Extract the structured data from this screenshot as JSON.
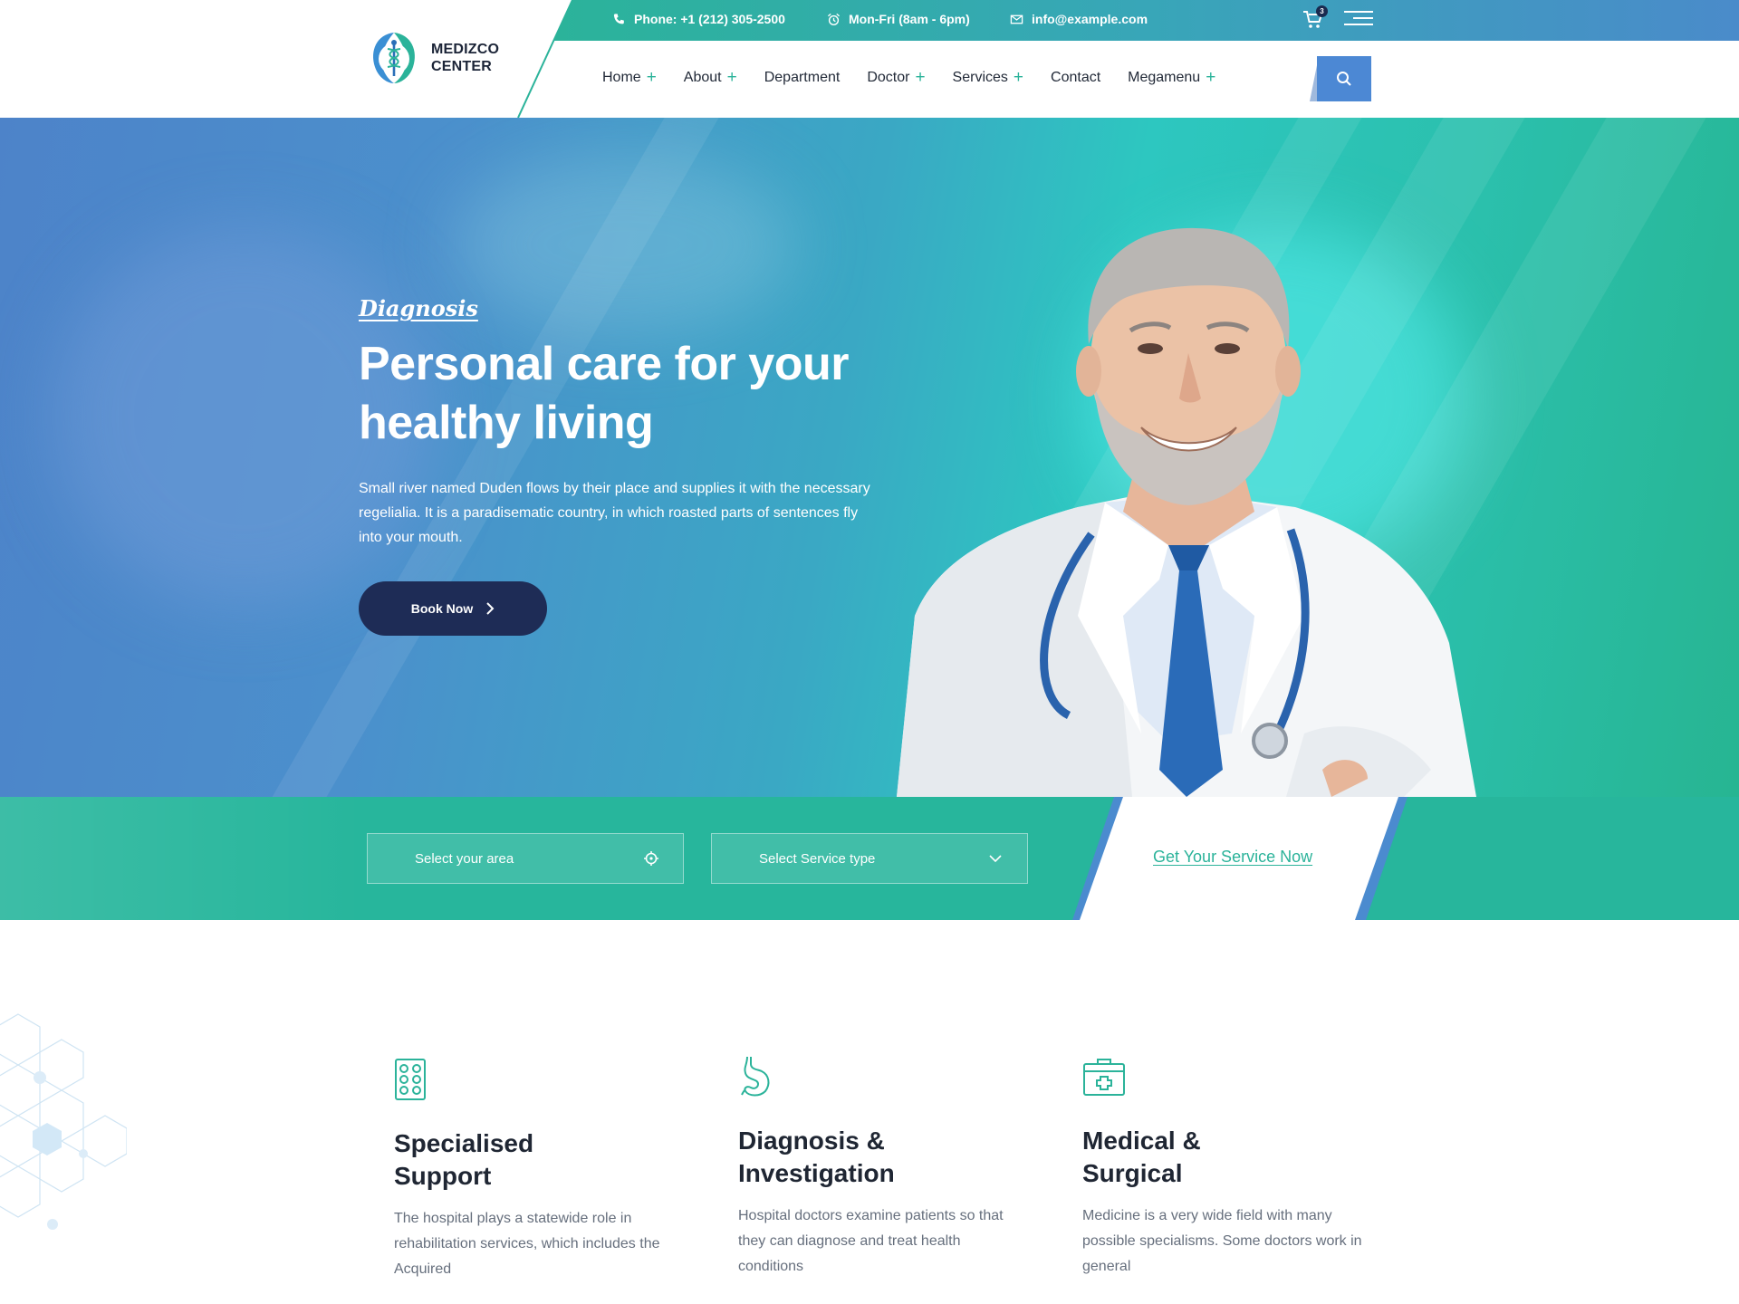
{
  "colors": {
    "accent": "#2bb39a",
    "primary": "#4c88d4",
    "dark": "#1e2c56"
  },
  "topbar": {
    "phone": "Phone: +1 (212) 305-2500",
    "hours": "Mon-Fri (8am - 6pm)",
    "email": "info@example.com",
    "cart_count": "3"
  },
  "logo": {
    "line1": "MEDIZCO",
    "line2": "CENTER"
  },
  "nav": {
    "items": [
      {
        "label": "Home",
        "has_submenu": true
      },
      {
        "label": "About",
        "has_submenu": true
      },
      {
        "label": "Department",
        "has_submenu": false
      },
      {
        "label": "Doctor",
        "has_submenu": true
      },
      {
        "label": "Services",
        "has_submenu": true
      },
      {
        "label": "Contact",
        "has_submenu": false
      },
      {
        "label": "Megamenu",
        "has_submenu": true
      }
    ],
    "plus_symbol": "+"
  },
  "hero": {
    "eyebrow": "Diagnosis",
    "title_line1": "Personal care for your",
    "title_line2": "healthy living",
    "text": "Small river named Duden flows by their place and supplies it with the necessary regelialia. It is a paradisematic country, in which roasted parts of sentences fly into your mouth.",
    "button": "Book Now"
  },
  "service_strip": {
    "area_placeholder": "Select your area",
    "service_placeholder": "Select Service type",
    "cta": "Get Your Service Now"
  },
  "features": [
    {
      "icon": "pill-pack-icon",
      "title_line1": "Specialised",
      "title_line2": "Support",
      "text": "The hospital plays a statewide role in rehabilitation services, which includes the Acquired"
    },
    {
      "icon": "stomach-icon",
      "title_line1": "Diagnosis &",
      "title_line2": "Investigation",
      "text": "Hospital doctors examine patients so that they can diagnose and treat health conditions"
    },
    {
      "icon": "medical-kit-icon",
      "title_line1": "Medical &",
      "title_line2": "Surgical",
      "text": "Medicine is a very wide field with many possible specialisms. Some doctors work in general"
    }
  ]
}
